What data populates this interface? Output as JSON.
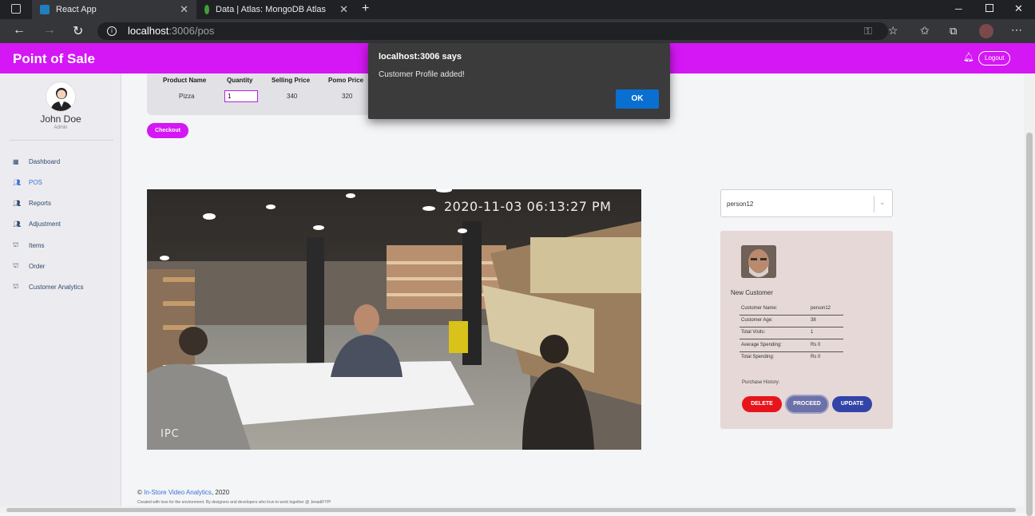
{
  "browser": {
    "tabs": [
      {
        "title": "React App",
        "active": true
      },
      {
        "title": "Data | Atlas: MongoDB Atlas",
        "active": false
      }
    ],
    "url_host": "localhost",
    "url_path": ":3006/pos"
  },
  "app": {
    "title": "Point of Sale",
    "logout_label": "Logout",
    "accent_color": "#d417f4"
  },
  "user": {
    "name": "John Doe",
    "role": "Admin"
  },
  "sidebar": {
    "items": [
      {
        "label": "Dashboard",
        "icon": "grid-icon"
      },
      {
        "label": "POS",
        "icon": "users-icon",
        "active": true
      },
      {
        "label": "Reports",
        "icon": "users-icon"
      },
      {
        "label": "Adjustment",
        "icon": "users-icon"
      },
      {
        "label": "Items",
        "icon": "basket-icon"
      },
      {
        "label": "Order",
        "icon": "basket-icon"
      },
      {
        "label": "Customer Analytics",
        "icon": "basket-icon"
      }
    ]
  },
  "cart": {
    "headers": [
      "Product Name",
      "Quantity",
      "Selling Price",
      "Pomo Price"
    ],
    "rows": [
      {
        "product": "Pizza",
        "quantity": "1",
        "selling_price": "340",
        "promo_price": "320"
      }
    ],
    "checkout_label": "Checkout"
  },
  "camera": {
    "timestamp": "2020-11-03 06:13:27 PM",
    "overlay_label": "IPC"
  },
  "person_select": {
    "value": "person12"
  },
  "customer": {
    "status": "New Customer",
    "fields": [
      {
        "label": "Customer Name:",
        "value": "person12"
      },
      {
        "label": "Customer Age:",
        "value": "38"
      },
      {
        "label": "Total Visits:",
        "value": "1"
      },
      {
        "label": "Average Spending:",
        "value": "Rs 0"
      },
      {
        "label": "Total Spending:",
        "value": "Rs 0"
      }
    ],
    "purchase_history_label": "Purchase History:",
    "buttons": {
      "delete": "DELETE",
      "proceed": "PROCEED",
      "update": "UPDATE"
    }
  },
  "footer": {
    "copyright_symbol": "©",
    "link_text": "In-Store Video Analytics",
    "year_text": ", 2020",
    "credit": "Created with love for the environment. By designers and developers who love to work together @ JenadiFYP!"
  },
  "dialog": {
    "title": "localhost:3006 says",
    "message": "Customer Profile added!",
    "ok_label": "OK"
  }
}
